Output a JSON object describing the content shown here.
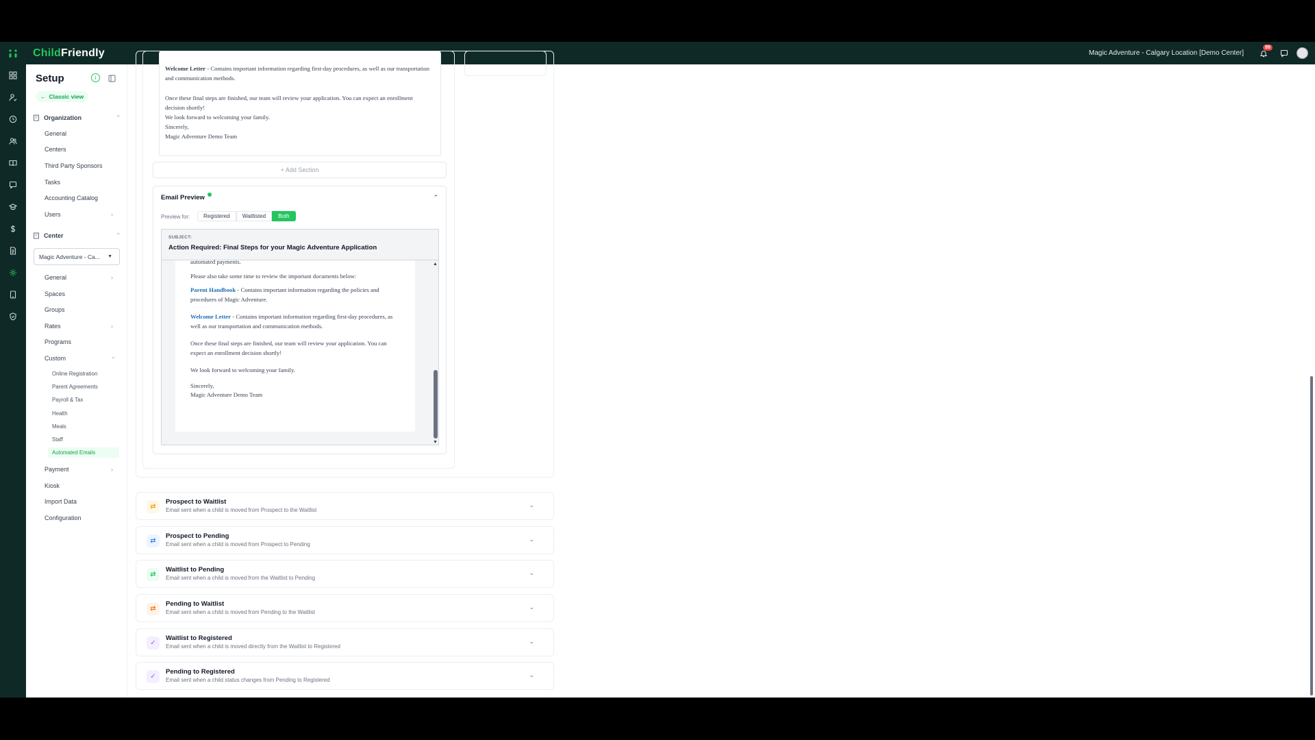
{
  "topbar": {
    "logo_a": "Ch",
    "logo_i": "i",
    "logo_b": "ld",
    "logo_c": "Fr",
    "logo_d": "i",
    "logo_e": "endly",
    "location": "Magic Adventure - Calgary Location [Demo Center]",
    "notification_count": "99"
  },
  "sidebar": {
    "title": "Setup",
    "info": "i",
    "classic_view": "Classic view",
    "organization": {
      "label": "Organization",
      "items": [
        "General",
        "Centers",
        "Third Party Sponsors",
        "Tasks",
        "Accounting Catalog",
        "Users"
      ]
    },
    "center": {
      "label": "Center",
      "selected": "Magic Adventure - Ca...",
      "items": [
        "General",
        "Spaces",
        "Groups",
        "Rates",
        "Programs",
        "Custom"
      ],
      "custom_sub": [
        "Online Registration",
        "Parent Agreements",
        "Payroll & Tax",
        "Health",
        "Meals",
        "Staff",
        "Automated Emails"
      ],
      "after": [
        "Payment",
        "Kiosk",
        "Import Data",
        "Configuration"
      ]
    }
  },
  "editor": {
    "wl_title": "Welcome Letter",
    "wl_text": " - Contains important information regarding first-day procedures, as well as our transportation and communication methods.",
    "final_steps": "Once these final steps are finished, our team will review your application. You can expect an enrollment decision shortly!",
    "forward": "We look forward to welcoming your family.",
    "sincerely": "Sincerely,",
    "team": "Magic Adventure Demo Team"
  },
  "add_section": "+ Add Section",
  "preview": {
    "title": "Email Preview",
    "preview_for": "Preview for:",
    "options": [
      "Registered",
      "Waitlisted",
      "Both"
    ],
    "subject_label": "SUBJECT:",
    "subject": "Action Required: Final Steps for your Magic Adventure Application",
    "body": {
      "top_cut": "automated payments.",
      "review": "Please also take some time to review the important documents below:",
      "ph_title": "Parent Handbook",
      "ph_text": " - Contains important information regarding the policies and procedures of Magic Adventure.",
      "wl_title": "Welcome Letter",
      "wl_text": " - Contains important information regarding first-day procedures, as well as our transportation and communication methods.",
      "final_steps": "Once these final steps are finished, our team will review your application. You can expect an enrollment decision shortly!",
      "forward": "We look forward to welcoming your family.",
      "sincerely": "Sincerely,",
      "team": "Magic Adventure Demo Team"
    }
  },
  "accordions": [
    {
      "title": "Prospect to Waitlist",
      "desc": "Email sent when a child is moved from Prospect to the Waitlist",
      "icon": "swap-icon",
      "color": "#f59e0b",
      "bg": "#fef6e7"
    },
    {
      "title": "Prospect to Pending",
      "desc": "Email sent when a child is moved from Prospect to Pending",
      "icon": "swap-icon",
      "color": "#3b82f6",
      "bg": "#eef4fe"
    },
    {
      "title": "Waitlist to Pending",
      "desc": "Email sent when a child is moved from the Waitlist to Pending",
      "icon": "swap-icon",
      "color": "#22c55e",
      "bg": "#ecfdf3"
    },
    {
      "title": "Pending to Waitlist",
      "desc": "Email sent when a child is moved from Pending to the Waitlist",
      "icon": "swap-icon",
      "color": "#f97316",
      "bg": "#fff3ea"
    },
    {
      "title": "Waitlist to Registered",
      "desc": "Email sent when a child is moved directly from the Waitlist to Registered",
      "icon": "check-circle-icon",
      "color": "#8b5cf6",
      "bg": "#f3effe"
    },
    {
      "title": "Pending to Registered",
      "desc": "Email sent when a child status changes from Pending to Registered",
      "icon": "check-circle-icon",
      "color": "#8b5cf6",
      "bg": "#f3effe"
    }
  ]
}
